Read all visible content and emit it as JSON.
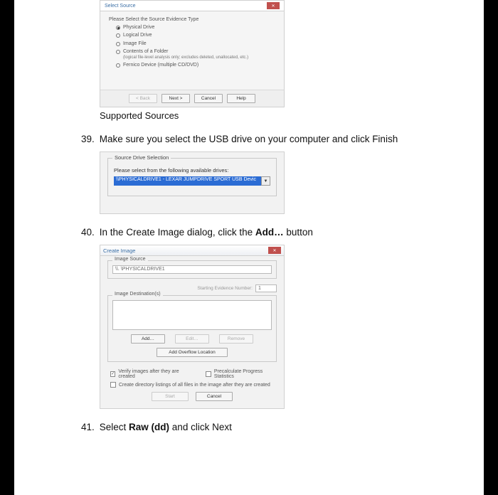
{
  "dlg1": {
    "title": "Select Source",
    "group_label": "Please Select the Source Evidence Type",
    "options_text": {
      "o1": "Physical Drive",
      "o2": "Logical Drive",
      "o3": "Image File",
      "o4": "Contents of a Folder",
      "o4_sub": "(logical file-level analysis only; excludes deleted, unallocated, etc.)",
      "o5": "Fernico Device (multiple CD/DVD)"
    },
    "buttons": {
      "back": "< Back",
      "next": "Next >",
      "cancel": "Cancel",
      "help": "Help"
    }
  },
  "caption1": "Supported Sources",
  "step39": {
    "num": "39.",
    "text": "Make sure you select the USB drive on your computer and click Finish"
  },
  "dlg2": {
    "legend": "Source Drive Selection",
    "note": "Please select from the following available drives:",
    "selected": "\\\\PHYSICALDRIVE1 - LEXAR JUMPDRIVE SPORT USB Devic"
  },
  "step40": {
    "num": "40.",
    "pre": "In the Create Image dialog, click the ",
    "bold": "Add…",
    "post": " button"
  },
  "dlg3": {
    "title": "Create Image",
    "src_legend": "Image Source",
    "src_value": "\\\\. \\PHYSICALDRIVE1",
    "ev_lbl": "Starting Evidence Number:",
    "ev_val": "1",
    "dest_legend": "Image Destination(s)",
    "btn_add": "Add…",
    "btn_edit": "Edit…",
    "btn_remove": "Remove",
    "btn_overflow": "Add Overflow Location",
    "chk1": "Verify images after they are created",
    "chk2": "Precalculate Progress Statistics",
    "chk3": "Create directory listings of all files in the image after they are created",
    "btn_start": "Start",
    "btn_cancel": "Cancel"
  },
  "step41": {
    "num": "41.",
    "pre": "Select ",
    "bold": "Raw (dd)",
    "post": " and click Next"
  }
}
